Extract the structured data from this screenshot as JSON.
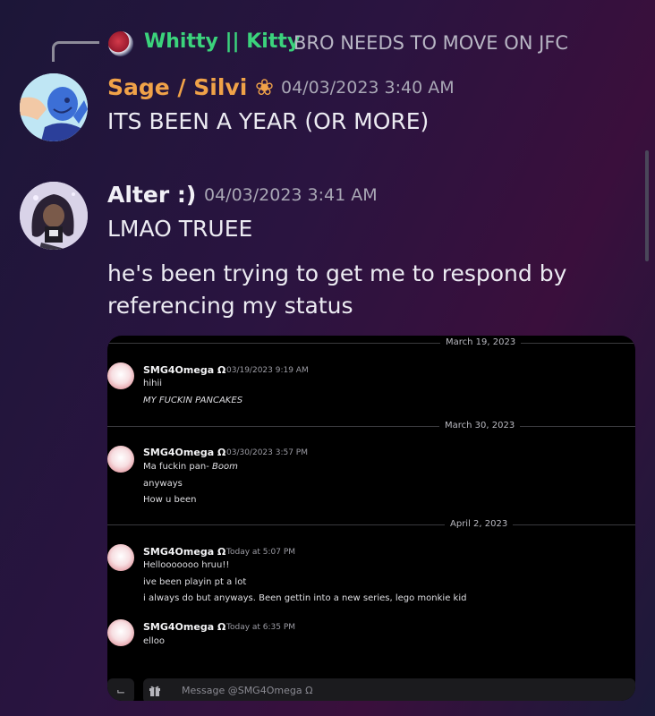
{
  "reply": {
    "author": "Whitty || Kitty",
    "text": "BRO NEEDS TO MOVE ON JFC",
    "author_color": "#3bd37c"
  },
  "messages": [
    {
      "author": "Sage / Silvi ❀",
      "timestamp": "04/03/2023 3:40 AM",
      "lines": [
        "ITS BEEN A YEAR (OR MORE)"
      ],
      "author_color": "#f0a248"
    },
    {
      "author": "Alter :)",
      "timestamp": "04/03/2023 3:41 AM",
      "lines": [
        "LMAO TRUEE",
        "he's been trying to get me to respond by referencing my status"
      ],
      "author_color": "#f1f0f6"
    }
  ],
  "attachment": {
    "dividers": [
      "March 19, 2023",
      "March 30, 2023",
      "April 2, 2023"
    ],
    "messages": [
      {
        "author": "SMG4Omega Ω",
        "timestamp": "03/19/2023 9:19 AM",
        "lines": [
          "hihii",
          "MY FUCKIN PANCAKES"
        ]
      },
      {
        "author": "SMG4Omega Ω",
        "timestamp": "03/30/2023 3:57 PM",
        "lines": [
          "Ma fuckin pan- ",
          "Boom",
          "anyways",
          "How u been"
        ]
      },
      {
        "author": "SMG4Omega Ω",
        "timestamp": "Today at 5:07 PM",
        "lines": [
          "Hellooooooo hruu!!",
          "ive been playin pt a lot",
          "i always do but anyways. Been gettin into a new series, lego monkie kid"
        ]
      },
      {
        "author": "SMG4Omega Ω",
        "timestamp": "Today at 6:35 PM",
        "lines": [
          "elloo"
        ]
      }
    ],
    "input_placeholder": "Message @SMG4Omega Ω"
  }
}
